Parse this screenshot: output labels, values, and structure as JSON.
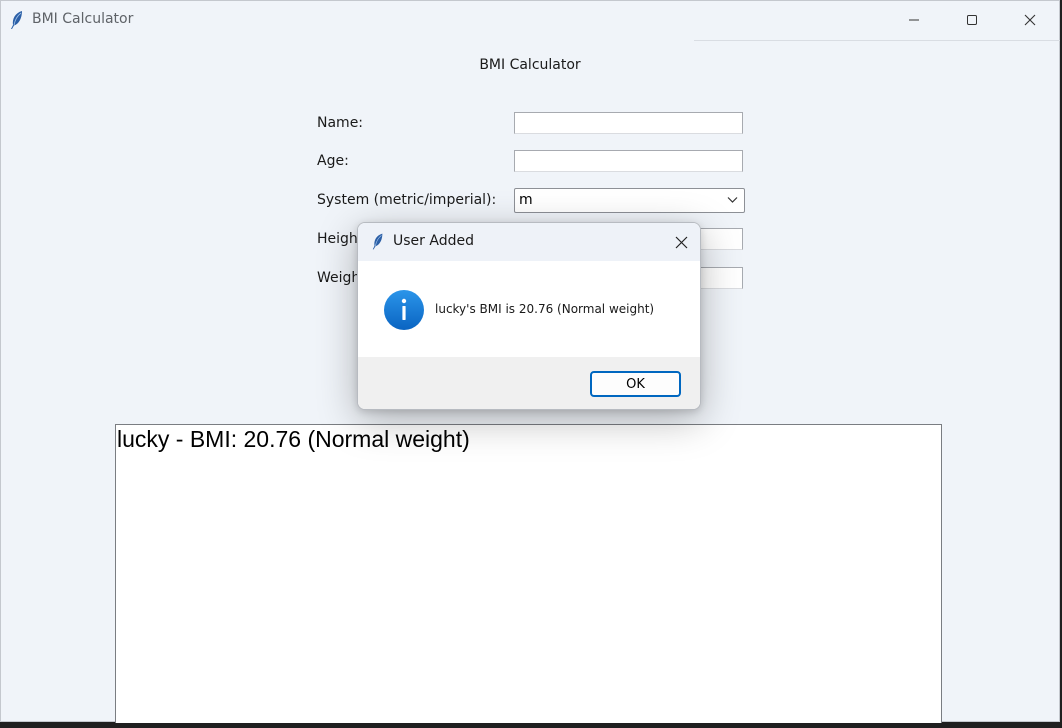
{
  "window": {
    "title": "BMI Calculator",
    "controls": {
      "minimize": "minimize-icon",
      "maximize": "maximize-icon",
      "close": "close-icon"
    }
  },
  "form": {
    "heading": "BMI Calculator",
    "fields": [
      {
        "label": "Name:",
        "value": ""
      },
      {
        "label": "Age:",
        "value": ""
      },
      {
        "label": "System (metric/imperial):",
        "value": "m"
      },
      {
        "label": "Heigh",
        "value": ""
      },
      {
        "label": "Weigh",
        "value": ""
      }
    ]
  },
  "results": {
    "rows": [
      "lucky - BMI: 20.76 (Normal weight)"
    ]
  },
  "dialog": {
    "title": "User Added",
    "icon": "info-icon",
    "message": "lucky's BMI is 20.76 (Normal weight)",
    "ok_label": "OK"
  },
  "colors": {
    "window_bg": "#f0f4f9",
    "accent": "#0067c0",
    "info_icon": "#1a7fd8"
  }
}
